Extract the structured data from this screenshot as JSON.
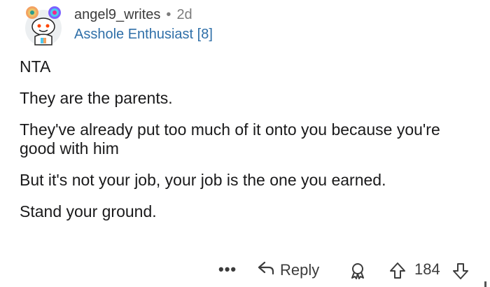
{
  "comment": {
    "username": "angel9_writes",
    "separator": "•",
    "time": "2d",
    "flair": "Asshole Enthusiast [8]",
    "paragraphs": [
      "NTA",
      "They are the parents.",
      "They've already put too much of it onto you because you're good with him",
      "But it's not your job, your job is the one you earned.",
      "Stand your ground."
    ]
  },
  "actions": {
    "more_label": "•••",
    "reply_label": "Reply",
    "score": "184"
  },
  "icons": {
    "avatar": "snoo-avatar-icon",
    "reply": "reply-arrow-icon",
    "award": "award-icon",
    "upvote": "upvote-arrow-icon",
    "downvote": "downvote-arrow-icon"
  }
}
